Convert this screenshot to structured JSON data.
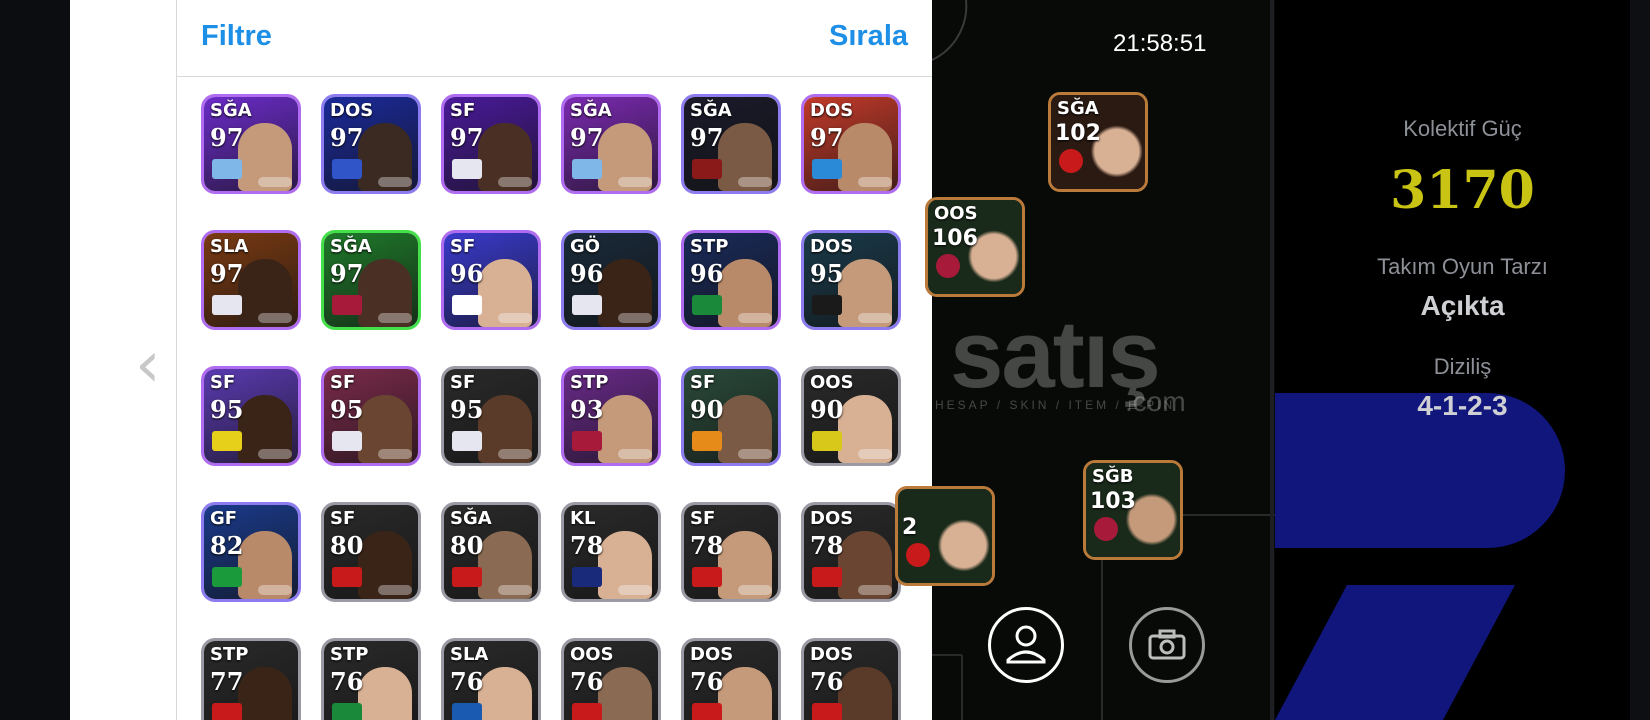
{
  "header": {
    "filter_label": "Filtre",
    "sort_label": "Sırala"
  },
  "clock": "21:58:51",
  "info": {
    "team_power_label": "Kolektif Güç",
    "team_power_value": "3170",
    "play_style_label": "Takım Oyun Tarzı",
    "play_style_value": "Açıkta",
    "formation_label": "Diziliş",
    "formation_value": "4-1-2-3"
  },
  "watermark": {
    "main": "satış",
    "sub": "HESAP / SKIN / ITEM / E-PIN",
    "com": ".com"
  },
  "players": [
    {
      "pos": "SĞA",
      "rating": "97",
      "bg": "#6b2cc9",
      "border": "#b06cf0",
      "badge": "#7fb8e8",
      "face": "#c49a7a"
    },
    {
      "pos": "DOS",
      "rating": "97",
      "bg": "#1b2a9a",
      "border": "#8d7bf0",
      "badge": "#2f55c8",
      "face": "#3b2a22"
    },
    {
      "pos": "SF",
      "rating": "97",
      "bg": "#4a1a9a",
      "border": "#b06cf0",
      "badge": "#e6e6f0",
      "face": "#4a3024"
    },
    {
      "pos": "SĞA",
      "rating": "97",
      "bg": "#7a2ab0",
      "border": "#b06cf0",
      "badge": "#7fb8e8",
      "face": "#c49a7a"
    },
    {
      "pos": "SĞA",
      "rating": "97",
      "bg": "#1a1a2a",
      "border": "#8d7bf0",
      "badge": "#8a1a1a",
      "face": "#7a5a44"
    },
    {
      "pos": "DOS",
      "rating": "97",
      "bg": "#c23a2a",
      "border": "#b06cf0",
      "badge": "#2a8ad8",
      "face": "#b88a6a"
    },
    {
      "pos": "SLA",
      "rating": "97",
      "bg": "#7a3a12",
      "border": "#b06cf0",
      "badge": "#e6e6f0",
      "face": "#3a2418"
    },
    {
      "pos": "SĞA",
      "rating": "97",
      "bg": "#1f7a2a",
      "border": "#44e04a",
      "badge": "#a81a3a",
      "face": "#4a3024"
    },
    {
      "pos": "SF",
      "rating": "96",
      "bg": "#3a3acc",
      "border": "#b06cf0",
      "badge": "#ffffff",
      "face": "#d8b094"
    },
    {
      "pos": "GÖ",
      "rating": "96",
      "bg": "#1a2a3a",
      "border": "#8d7bf0",
      "badge": "#e6e6f0",
      "face": "#3a2418"
    },
    {
      "pos": "STP",
      "rating": "96",
      "bg": "#1a2a5a",
      "border": "#b06cf0",
      "badge": "#1a8a3a",
      "face": "#b88a6a"
    },
    {
      "pos": "DOS",
      "rating": "95",
      "bg": "#1a3a4a",
      "border": "#8d7bf0",
      "badge": "#1a1a1a",
      "face": "#c49a7a"
    },
    {
      "pos": "SF",
      "rating": "95",
      "bg": "#5a3ab0",
      "border": "#b06cf0",
      "badge": "#e6d01a",
      "face": "#3a2418"
    },
    {
      "pos": "SF",
      "rating": "95",
      "bg": "#7a2a4a",
      "border": "#b06cf0",
      "badge": "#e6e6f0",
      "face": "#6a4632"
    },
    {
      "pos": "SF",
      "rating": "95",
      "bg": "#2a2a2a",
      "border": "#9a9aa4",
      "badge": "#e6e6f0",
      "face": "#5a3a28"
    },
    {
      "pos": "STP",
      "rating": "93",
      "bg": "#6a2a8a",
      "border": "#b06cf0",
      "badge": "#a81a3a",
      "face": "#c49a7a"
    },
    {
      "pos": "SF",
      "rating": "90",
      "bg": "#2a4a3a",
      "border": "#8d7bf0",
      "badge": "#e68a1a",
      "face": "#7a5a44"
    },
    {
      "pos": "OOS",
      "rating": "90",
      "bg": "#2a2a2a",
      "border": "#9a9aa4",
      "badge": "#d8c81a",
      "face": "#d8b094"
    },
    {
      "pos": "GF",
      "rating": "82",
      "bg": "#1a3a8a",
      "border": "#8d7bf0",
      "badge": "#1a9a3a",
      "face": "#b88a6a"
    },
    {
      "pos": "SF",
      "rating": "80",
      "bg": "#2a2a2a",
      "border": "#9a9aa4",
      "badge": "#c81a1a",
      "face": "#3a2418"
    },
    {
      "pos": "SĞA",
      "rating": "80",
      "bg": "#2a2a2a",
      "border": "#9a9aa4",
      "badge": "#c81a1a",
      "face": "#8a6a52"
    },
    {
      "pos": "KL",
      "rating": "78",
      "bg": "#2a2a2a",
      "border": "#9a9aa4",
      "badge": "#1a2a7a",
      "face": "#d8b094"
    },
    {
      "pos": "SF",
      "rating": "78",
      "bg": "#2a2a2a",
      "border": "#9a9aa4",
      "badge": "#c81a1a",
      "face": "#c49a7a"
    },
    {
      "pos": "DOS",
      "rating": "78",
      "bg": "#2a2a2a",
      "border": "#9a9aa4",
      "badge": "#c81a1a",
      "face": "#6a4632"
    },
    {
      "pos": "STP",
      "rating": "77",
      "bg": "#2a2a2a",
      "border": "#9a9aa4",
      "badge": "#c81a1a",
      "face": "#3a2418"
    },
    {
      "pos": "STP",
      "rating": "76",
      "bg": "#2a2a2a",
      "border": "#9a9aa4",
      "badge": "#1a8a3a",
      "face": "#d8b094"
    },
    {
      "pos": "SLA",
      "rating": "76",
      "bg": "#2a2a2a",
      "border": "#9a9aa4",
      "badge": "#1a5ab0",
      "face": "#d8b094"
    },
    {
      "pos": "OOS",
      "rating": "76",
      "bg": "#2a2a2a",
      "border": "#9a9aa4",
      "badge": "#c81a1a",
      "face": "#8a6a52"
    },
    {
      "pos": "DOS",
      "rating": "76",
      "bg": "#2a2a2a",
      "border": "#9a9aa4",
      "badge": "#c81a1a",
      "face": "#c49a7a"
    },
    {
      "pos": "DOS",
      "rating": "76",
      "bg": "#2a2a2a",
      "border": "#9a9aa4",
      "badge": "#c81a1a",
      "face": "#5a3a28"
    }
  ],
  "pitch_players": [
    {
      "pos": "SĞA",
      "rating": "102",
      "bg": "#2a1a12",
      "badge": "#c81a1a",
      "face": "#d8b094"
    },
    {
      "pos": "OOS",
      "rating": "106",
      "bg": "#1a2a1a",
      "badge": "#a81a3a",
      "face": "#d8b094"
    },
    {
      "pos": "SĞB",
      "rating": "103",
      "bg": "#1a2a1a",
      "badge": "#a81a3a",
      "face": "#c49a7a"
    },
    {
      "pos": "",
      "rating": "2",
      "bg": "#1a2a1a",
      "badge": "#c81a1a",
      "face": "#d8b094"
    }
  ]
}
